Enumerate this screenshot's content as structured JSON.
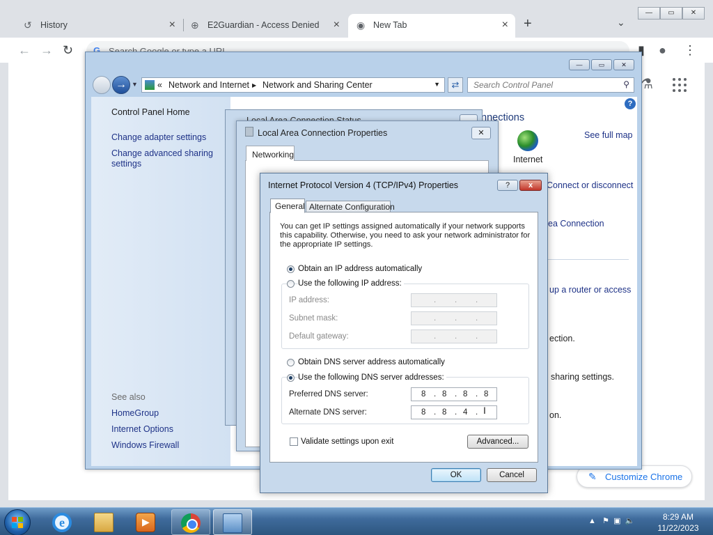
{
  "browser": {
    "tabs": [
      {
        "label": "History",
        "icon": "history-icon"
      },
      {
        "label": "E2Guardian - Access Denied",
        "icon": "globe-icon"
      },
      {
        "label": "New Tab",
        "icon": "chrome-icon"
      }
    ],
    "omnibox_placeholder": "Search Google or type a URL",
    "customize_label": "Customize Chrome"
  },
  "control_panel": {
    "breadcrumb_prefix": "«",
    "breadcrumb": [
      "Network and Internet",
      "Network and Sharing Center"
    ],
    "search_placeholder": "Search Control Panel",
    "left_links": [
      "Control Panel Home",
      "Change adapter settings",
      "Change advanced sharing",
      "settings"
    ],
    "see_also": "See also",
    "see_also_links": [
      "HomeGroup",
      "Internet Options",
      "Windows Firewall"
    ],
    "right_fragments": {
      "heading": "nnections",
      "full_map": "See full map",
      "internet": "Internet",
      "connect": "Connect or disconnect",
      "area_connection": "ea Connection",
      "router": "up a router or access",
      "ection": "ection.",
      "sharing": "sharing settings.",
      "on": "on."
    }
  },
  "status_window": {
    "title": "Local Area Connection Status"
  },
  "lac_properties": {
    "title": "Local Area Connection Properties",
    "tab": "Networking"
  },
  "ipv4": {
    "title": "Internet Protocol Version 4 (TCP/IPv4) Properties",
    "help_label": "?",
    "close_label": "x",
    "tabs": [
      "General",
      "Alternate Configuration"
    ],
    "description": "You can get IP settings assigned automatically if your network supports this capability. Otherwise, you need to ask your network administrator for the appropriate IP settings.",
    "obtain_ip_auto": "Obtain an IP address automatically",
    "use_following_ip": "Use the following IP address:",
    "ip_address_label": "IP address:",
    "subnet_mask_label": "Subnet mask:",
    "default_gateway_label": "Default gateway:",
    "obtain_dns_auto": "Obtain DNS server address automatically",
    "use_following_dns": "Use the following DNS server addresses:",
    "preferred_dns_label": "Preferred DNS server:",
    "alternate_dns_label": "Alternate DNS server:",
    "preferred_dns": [
      "8",
      "8",
      "8",
      "8"
    ],
    "alternate_dns": [
      "8",
      "8",
      "4",
      ""
    ],
    "validate_label": "Validate settings upon exit",
    "advanced_label": "Advanced...",
    "ok_label": "OK",
    "cancel_label": "Cancel"
  },
  "taskbar": {
    "time": "8:29 AM",
    "date": "11/22/2023"
  }
}
